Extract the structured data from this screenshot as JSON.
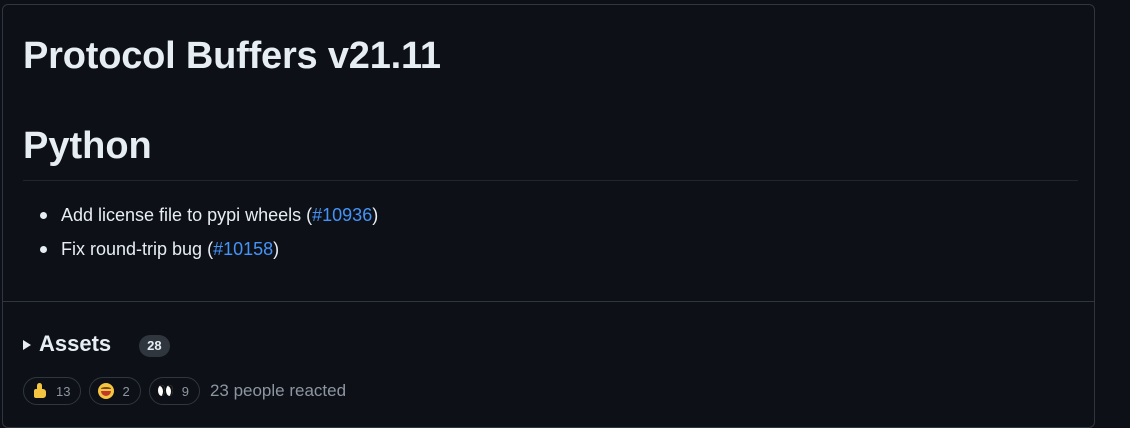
{
  "release": {
    "title": "Protocol Buffers v21.11",
    "section_heading": "Python",
    "notes": [
      {
        "text": "Add license file to pypi wheels (",
        "link": "#10936",
        "suffix": ")"
      },
      {
        "text": "Fix round-trip bug (",
        "link": "#10158",
        "suffix": ")"
      }
    ]
  },
  "assets": {
    "label": "Assets",
    "count": "28"
  },
  "reactions": {
    "items": [
      {
        "icon": "thumbs-up-icon",
        "count": "13"
      },
      {
        "icon": "smile-icon",
        "count": "2"
      },
      {
        "icon": "eyes-icon",
        "count": "9"
      }
    ],
    "summary": "23 people reacted"
  },
  "colors": {
    "background": "#0d1117",
    "border": "#30363d",
    "link": "#4493f8",
    "muted_text": "#8d96a0"
  }
}
